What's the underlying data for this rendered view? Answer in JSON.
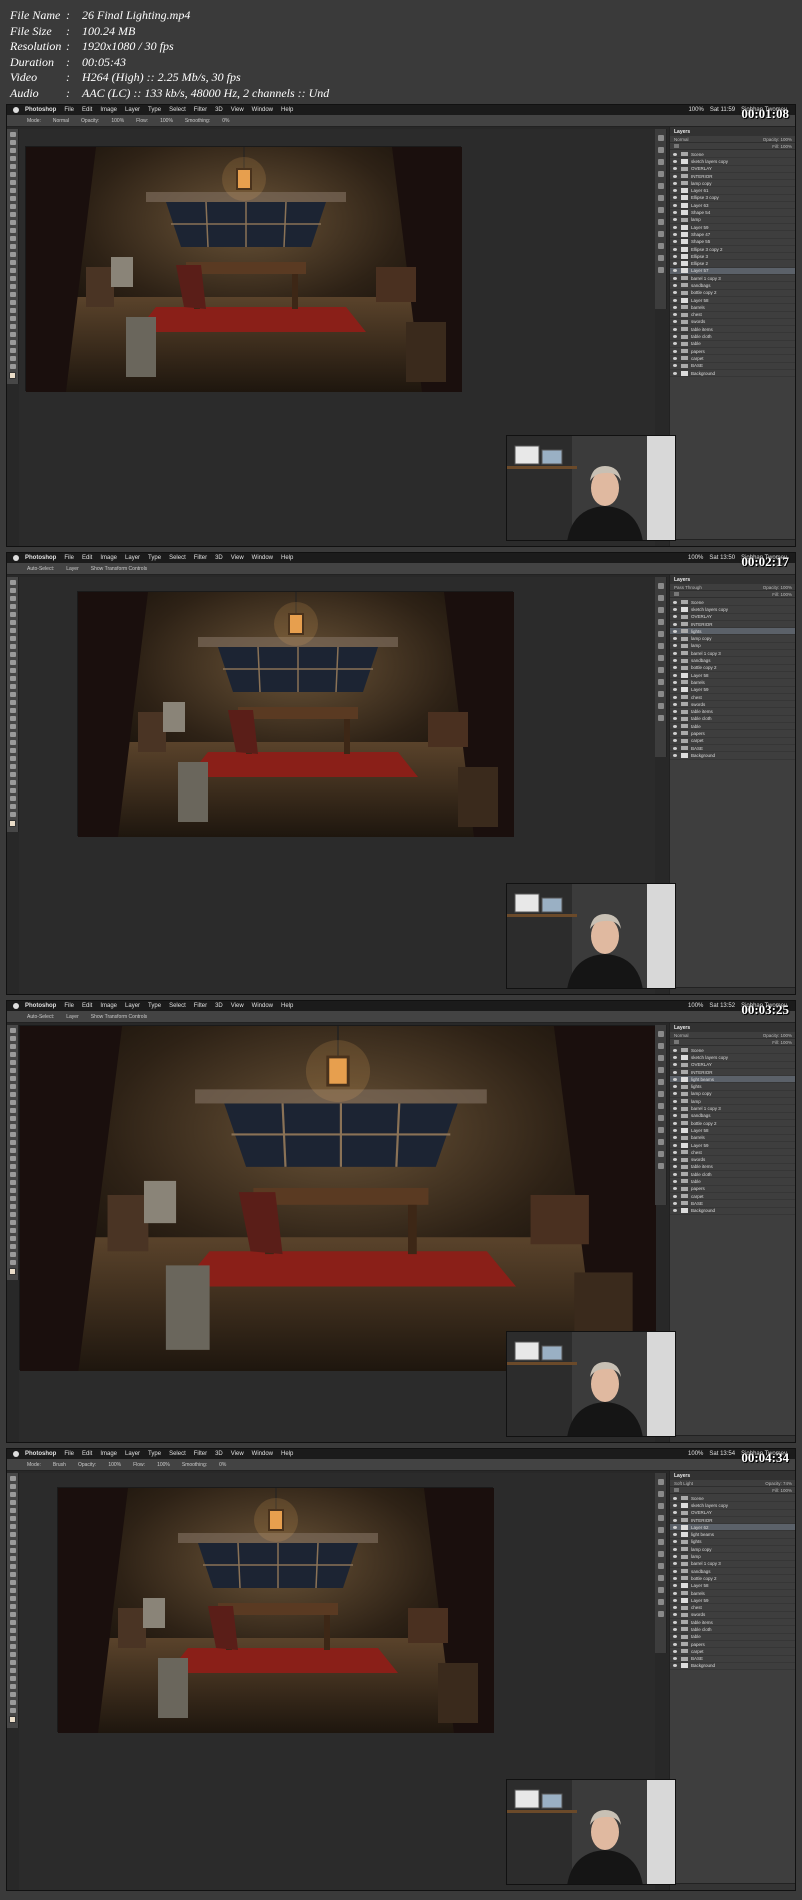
{
  "meta": [
    {
      "key": "File Name",
      "value": "26 Final Lighting.mp4"
    },
    {
      "key": "File Size",
      "value": "100.24 MB"
    },
    {
      "key": "Resolution",
      "value": "1920x1080 / 30 fps"
    },
    {
      "key": "Duration",
      "value": "00:05:43"
    },
    {
      "key": "Video",
      "value": "H264 (High) :: 2.25 Mb/s, 30 fps"
    },
    {
      "key": "Audio",
      "value": "AAC (LC) :: 133 kb/s, 48000 Hz, 2 channels :: Und"
    }
  ],
  "menu": [
    "Photoshop",
    "File",
    "Edit",
    "Image",
    "Layer",
    "Type",
    "Select",
    "Filter",
    "3D",
    "View",
    "Window",
    "Help"
  ],
  "status_user": "Siobhan Twomey",
  "battery": "100%",
  "frames": [
    {
      "timecode": "00:01:08",
      "clock": "Sat 11:59",
      "options": [
        "Mode:",
        "Normal",
        "Opacity:",
        "100%",
        "Flow:",
        "100%",
        "Smoothing:",
        "0%"
      ],
      "layers_title": "Layers",
      "blend": "Normal",
      "opacity": "Opacity: 100%",
      "fill": "Fill: 100%",
      "layers": [
        "Scene",
        "sketch layers copy",
        "OVERLAY",
        "INTERIOR",
        "lamp copy",
        "Layer 61",
        "Ellipse 3 copy",
        "Layer 63",
        "Shape 54",
        "lamp",
        "Layer 59",
        "Shape 47",
        "Shape 55",
        "Ellipse 3 copy 2",
        "Ellipse 3",
        "Ellipse 2",
        "Layer 57",
        "barrel 1 copy 3",
        "sandbags",
        "bottle copy 2",
        "Layer 58",
        "barrels",
        "chest",
        "swords",
        "table items",
        "table cloth",
        "table",
        "papers",
        "carpet",
        "BASE",
        "Background"
      ],
      "selected": 16
    },
    {
      "timecode": "00:02:17",
      "clock": "Sat 13:50",
      "options": [
        "Auto-Select:",
        "Layer",
        "Show Transform Controls"
      ],
      "layers_title": "Layers",
      "blend": "Pass Through",
      "opacity": "Opacity: 100%",
      "fill": "Fill: 100%",
      "layers": [
        "Scene",
        "sketch layers copy",
        "OVERLAY",
        "INTERIOR",
        "lights",
        "lamp copy",
        "lamp",
        "barrel 1 copy 3",
        "sandbags",
        "bottle copy 2",
        "Layer 58",
        "barrels",
        "Layer 59",
        "chest",
        "swords",
        "table items",
        "table cloth",
        "table",
        "papers",
        "carpet",
        "BASE",
        "Background"
      ],
      "selected": 4
    },
    {
      "timecode": "00:03:25",
      "clock": "Sat 13:52",
      "options": [
        "Auto-Select:",
        "Layer",
        "Show Transform Controls"
      ],
      "layers_title": "Layers",
      "blend": "Normal",
      "opacity": "Opacity: 100%",
      "fill": "Fill: 100%",
      "layers": [
        "Scene",
        "sketch layers copy",
        "OVERLAY",
        "INTERIOR",
        "light beams",
        "lights",
        "lamp copy",
        "lamp",
        "barrel 1 copy 3",
        "sandbags",
        "bottle copy 2",
        "Layer 58",
        "barrels",
        "Layer 59",
        "chest",
        "swords",
        "table items",
        "table cloth",
        "table",
        "papers",
        "carpet",
        "BASE",
        "Background"
      ],
      "selected": 4
    },
    {
      "timecode": "00:04:34",
      "clock": "Sat 13:54",
      "options": [
        "Mode:",
        "Brush",
        "Opacity:",
        "100%",
        "Flow:",
        "100%",
        "Smoothing:",
        "0%"
      ],
      "layers_title": "Layers",
      "blend": "Soft Light",
      "opacity": "Opacity: 74%",
      "fill": "Fill: 100%",
      "layers": [
        "Scene",
        "sketch layers copy",
        "OVERLAY",
        "INTERIOR",
        "Layer 62",
        "light beams",
        "lights",
        "lamp copy",
        "lamp",
        "barrel 1 copy 3",
        "sandbags",
        "bottle copy 2",
        "Layer 58",
        "barrels",
        "Layer 59",
        "chest",
        "swords",
        "table items",
        "table cloth",
        "table",
        "papers",
        "carpet",
        "BASE",
        "Background"
      ],
      "selected": 4
    }
  ]
}
